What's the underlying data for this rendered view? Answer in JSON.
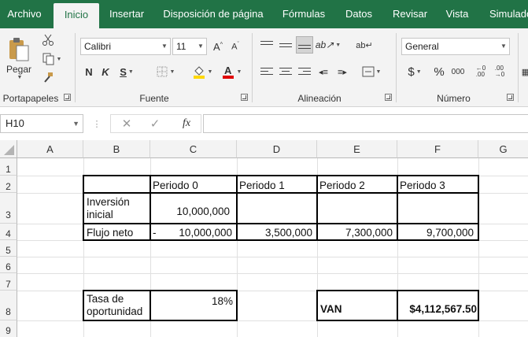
{
  "ribbon_tabs": [
    "Archivo",
    "Inicio",
    "Insertar",
    "Disposición de página",
    "Fórmulas",
    "Datos",
    "Revisar",
    "Vista",
    "Simulador"
  ],
  "active_tab": "Inicio",
  "clipboard": {
    "paste_label": "Pegar",
    "group_label": "Portapapeles"
  },
  "font": {
    "name": "Calibri",
    "size": "11",
    "bold": "N",
    "italic": "K",
    "underline": "S",
    "group_label": "Fuente"
  },
  "alignment": {
    "group_label": "Alineación"
  },
  "number": {
    "format": "General",
    "currency": "$",
    "percent": "%",
    "thousands": "000",
    "group_label": "Número"
  },
  "formula_bar": {
    "name_box": "H10",
    "fx": "fx",
    "formula": ""
  },
  "columns": [
    "A",
    "B",
    "C",
    "D",
    "E",
    "F",
    "G"
  ],
  "rows": [
    "1",
    "2",
    "3",
    "4",
    "5",
    "6",
    "7",
    "8",
    "9"
  ],
  "cells": {
    "B2": "",
    "C2": "Periodo 0",
    "D2": "Periodo 1",
    "E2": "Periodo 2",
    "F2": "Periodo 3",
    "B3": "Inversión\ninicial",
    "C3": "10,000,000",
    "B4": "Flujo neto",
    "C4_sign": "-",
    "C4": "10,000,000",
    "D4": "3,500,000",
    "E4": "7,300,000",
    "F4": "9,700,000",
    "B8": "Tasa de\noportunidad",
    "C8": "18%",
    "E8": "VAN",
    "F8": "$4,112,567.50"
  },
  "colors": {
    "accent": "#217346",
    "ribbon_bg": "#f3f3f3",
    "font_color_red": "#e00000",
    "fill_yellow": "#ffd800"
  }
}
